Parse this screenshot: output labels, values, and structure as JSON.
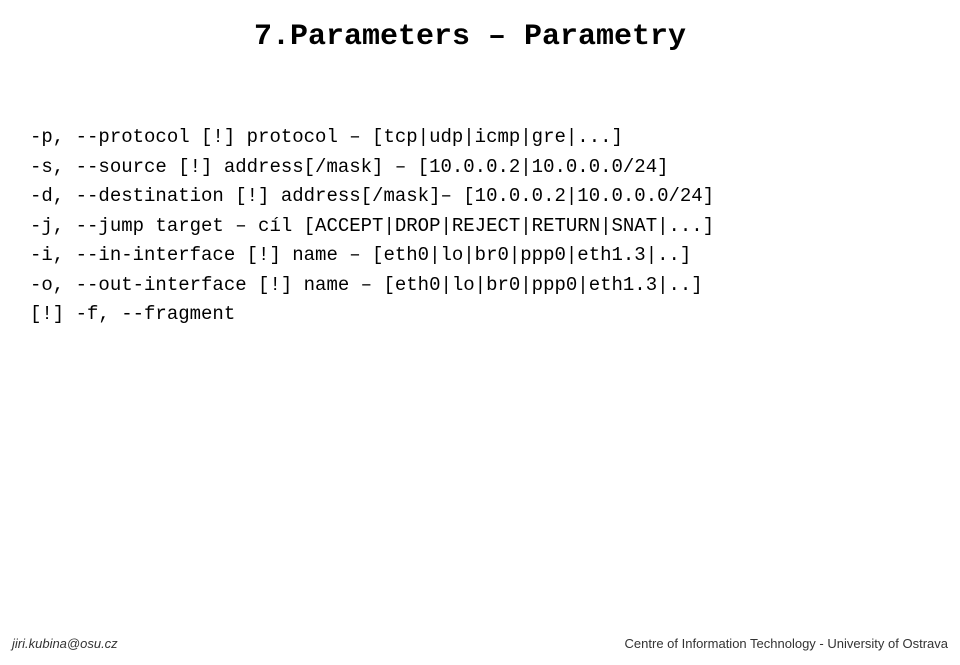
{
  "title": "7.Parameters – Parametry",
  "lines": [
    "-p, --protocol [!] protocol – [tcp|udp|icmp|gre|...]",
    "-s, --source [!] address[/mask] – [10.0.0.2|10.0.0.0/24]",
    "-d, --destination [!] address[/mask]– [10.0.0.2|10.0.0.0/24]",
    "-j, --jump target – cíl [ACCEPT|DROP|REJECT|RETURN|SNAT|...]",
    "-i, --in-interface [!] name – [eth0|lo|br0|ppp0|eth1.3|..]",
    "-o, --out-interface [!] name – [eth0|lo|br0|ppp0|eth1.3|..]",
    "[!] -f, --fragment"
  ],
  "footer": {
    "left": "jiri.kubina@osu.cz",
    "right": "Centre of Information Technology - University of Ostrava"
  }
}
